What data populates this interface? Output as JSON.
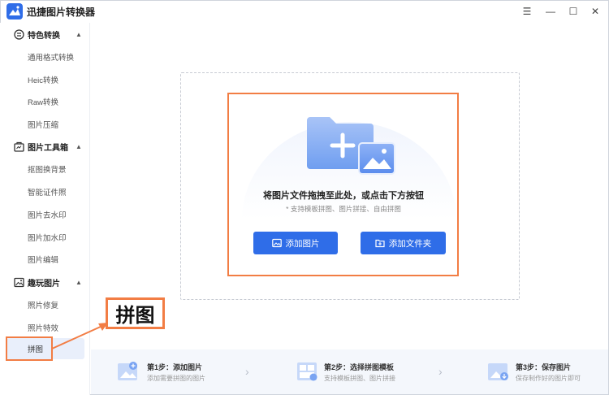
{
  "app": {
    "title": "迅捷图片转换器"
  },
  "window_controls": {
    "menu": "☰",
    "minimize": "—",
    "maximize": "☐",
    "close": "✕"
  },
  "sidebar": {
    "groups": [
      {
        "label": "特色转换",
        "icon": "format-icon",
        "items": [
          "通用格式转换",
          "Heic转换",
          "Raw转换",
          "图片压缩"
        ]
      },
      {
        "label": "图片工具箱",
        "icon": "toolbox-icon",
        "items": [
          "抠图换背景",
          "智能证件照",
          "图片去水印",
          "图片加水印",
          "图片编辑"
        ]
      },
      {
        "label": "趣玩图片",
        "icon": "fun-image-icon",
        "items": [
          "照片修复",
          "照片特效",
          "拼图"
        ]
      }
    ],
    "active_item": "拼图"
  },
  "callout": {
    "label": "拼图"
  },
  "dropzone": {
    "main_text": "将图片文件拖拽至此处，或点击下方按钮",
    "sub_text": "* 支持模板拼图、图片拼接、自由拼图",
    "add_image_label": "添加图片",
    "add_folder_label": "添加文件夹"
  },
  "steps": [
    {
      "title": "第1步：添加图片",
      "desc": "添加需要拼图的图片"
    },
    {
      "title": "第2步：选择拼图模板",
      "desc": "支持模板拼图、图片拼接"
    },
    {
      "title": "第3步：保存图片",
      "desc": "保存制作好的图片即可"
    }
  ],
  "colors": {
    "accent": "#2f6de8",
    "highlight": "#f27d44",
    "active_bg": "#e9effb"
  }
}
